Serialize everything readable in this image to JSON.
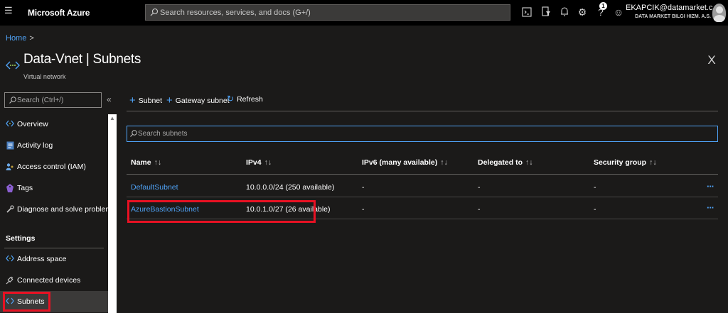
{
  "topbar": {
    "menu_icon": "hamburger-icon",
    "brand": "Microsoft Azure",
    "search_placeholder": "Search resources, services, and docs (G+/)",
    "icons": [
      "cloud-shell-icon",
      "directory-filter-icon",
      "notifications-icon",
      "settings-icon",
      "help-icon",
      "feedback-icon"
    ],
    "notification_count": "1",
    "account": {
      "user": "EKAPCIK@datamarket.c...",
      "org": "DATA MARKET BILGI HIZM. A.S."
    }
  },
  "breadcrumb": {
    "home": "Home",
    "separator": ">"
  },
  "header": {
    "title": "Data-Vnet | Subnets",
    "subtitle": "Virtual network",
    "close_glyph": "X"
  },
  "sidebar": {
    "search_placeholder": "Search (Ctrl+/)",
    "collapse_glyph": "«",
    "items": [
      {
        "label": "Overview",
        "icon": "vnet-icon"
      },
      {
        "label": "Activity log",
        "icon": "activity-log-icon"
      },
      {
        "label": "Access control (IAM)",
        "icon": "iam-icon"
      },
      {
        "label": "Tags",
        "icon": "tag-icon"
      },
      {
        "label": "Diagnose and solve problems",
        "icon": "wrench-icon"
      }
    ],
    "section_settings": "Settings",
    "settings_items": [
      {
        "label": "Address space",
        "icon": "vnet-icon"
      },
      {
        "label": "Connected devices",
        "icon": "plug-icon"
      },
      {
        "label": "Subnets",
        "icon": "subnet-icon",
        "active": true
      }
    ]
  },
  "toolbar": {
    "subnet": "Subnet",
    "gateway_subnet": "Gateway subnet",
    "refresh": "Refresh"
  },
  "subnet_search": {
    "placeholder": "Search subnets"
  },
  "table": {
    "sort_glyph": "↑↓",
    "columns": [
      "Name",
      "IPv4",
      "IPv6 (many available)",
      "Delegated to",
      "Security group"
    ],
    "rows": [
      {
        "name": "DefaultSubnet",
        "ipv4": "10.0.0.0/24 (250 available)",
        "ipv6": "-",
        "delegated": "-",
        "security_group": "-",
        "more": "···"
      },
      {
        "name": "AzureBastionSubnet",
        "ipv4": "10.0.1.0/27 (26 available)",
        "ipv6": "-",
        "delegated": "-",
        "security_group": "-",
        "more": "···"
      }
    ]
  },
  "colors": {
    "accent": "#4fa3f7",
    "highlight": "#e81123",
    "background": "#1b1a19",
    "topbar": "#000000"
  }
}
